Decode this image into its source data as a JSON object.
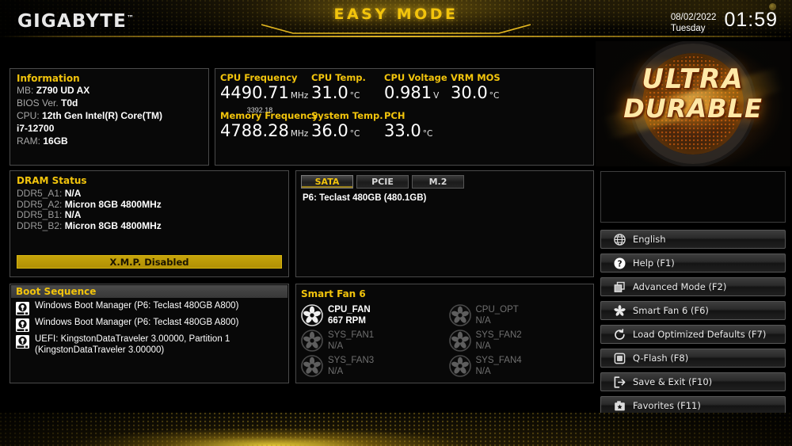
{
  "header": {
    "brand": "GIGABYTE",
    "brand_tm": "™",
    "mode_title": "EASY MODE",
    "date": "08/02/2022",
    "weekday": "Tuesday",
    "time": "01:59"
  },
  "information": {
    "title": "Information",
    "rows": [
      {
        "label": "MB:",
        "value": "Z790 UD AX"
      },
      {
        "label": "BIOS Ver.",
        "value": "T0d"
      },
      {
        "label": "CPU:",
        "value": "12th Gen Intel(R) Core(TM)"
      },
      {
        "label": "",
        "value": "i7-12700"
      },
      {
        "label": "RAM:",
        "value": "16GB"
      }
    ]
  },
  "sensors": [
    {
      "label": "CPU Frequency",
      "value": "4490.71",
      "unit": "MHz",
      "sub": "3392.18"
    },
    {
      "label": "CPU Temp.",
      "value": "31.0",
      "unit": "°C"
    },
    {
      "label": "CPU Voltage",
      "value": "0.981",
      "unit": "V"
    },
    {
      "label": "VRM MOS",
      "value": "30.0",
      "unit": "°C"
    },
    {
      "label": "Memory Frequency",
      "value": "4788.28",
      "unit": "MHz"
    },
    {
      "label": "System Temp.",
      "value": "36.0",
      "unit": "°C"
    },
    {
      "label": "PCH",
      "value": "33.0",
      "unit": "°C"
    }
  ],
  "dram": {
    "title": "DRAM Status",
    "slots": [
      {
        "label": "DDR5_A1:",
        "value": "N/A"
      },
      {
        "label": "DDR5_A2:",
        "value": "Micron 8GB 4800MHz"
      },
      {
        "label": "DDR5_B1:",
        "value": "N/A"
      },
      {
        "label": "DDR5_B2:",
        "value": "Micron 8GB 4800MHz"
      }
    ],
    "xmp_label": "X.M.P.  Disabled"
  },
  "storage": {
    "tabs": [
      {
        "label": "SATA",
        "active": true
      },
      {
        "label": "PCIE",
        "active": false
      },
      {
        "label": "M.2",
        "active": false
      }
    ],
    "items": [
      "P6: Teclast 480GB  (480.1GB)"
    ]
  },
  "boot": {
    "title": "Boot Sequence",
    "items": [
      {
        "icon": "hard-drive-icon",
        "text": "Windows Boot Manager (P6: Teclast 480GB A800)"
      },
      {
        "icon": "hard-drive-icon",
        "text": "Windows Boot Manager (P6: Teclast 480GB A800)"
      },
      {
        "icon": "hard-drive-icon",
        "text": "UEFI: KingstonDataTraveler 3.00000, Partition 1 (KingstonDataTraveler 3.00000)"
      }
    ]
  },
  "fans": {
    "title": "Smart Fan 6",
    "items": [
      {
        "name": "CPU_FAN",
        "rpm": "667 RPM",
        "active": true
      },
      {
        "name": "CPU_OPT",
        "rpm": "N/A",
        "active": false
      },
      {
        "name": "SYS_FAN1",
        "rpm": "N/A",
        "active": false
      },
      {
        "name": "SYS_FAN2",
        "rpm": "N/A",
        "active": false
      },
      {
        "name": "SYS_FAN3",
        "rpm": "N/A",
        "active": false
      },
      {
        "name": "SYS_FAN4",
        "rpm": "N/A",
        "active": false
      }
    ]
  },
  "ultra_durable": {
    "line1": "ULTRA",
    "line2": "DURABLE"
  },
  "menu": [
    {
      "icon": "globe-icon",
      "label": "English"
    },
    {
      "icon": "help-icon",
      "label": "Help (F1)"
    },
    {
      "icon": "windows-icon",
      "label": "Advanced Mode (F2)"
    },
    {
      "icon": "fan-icon",
      "label": "Smart Fan 6 (F6)"
    },
    {
      "icon": "reload-icon",
      "label": "Load Optimized Defaults (F7)"
    },
    {
      "icon": "chip-icon",
      "label": "Q-Flash (F8)"
    },
    {
      "icon": "exit-icon",
      "label": "Save & Exit (F10)"
    },
    {
      "icon": "star-box-icon",
      "label": "Favorites (F11)"
    }
  ],
  "colors": {
    "accent": "#f2c40c",
    "panel_border": "#4a4a4a",
    "background": "#000000",
    "xmp_bar": "#c6a40a"
  }
}
